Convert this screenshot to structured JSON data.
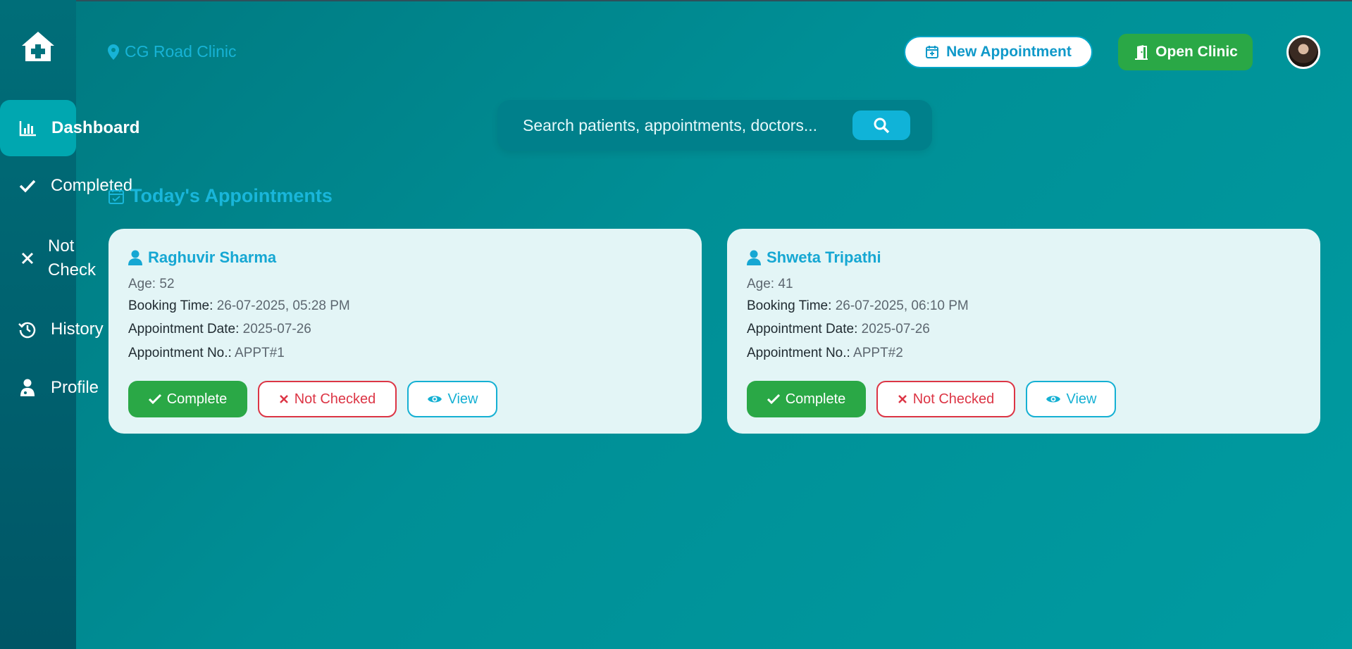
{
  "sidebar": {
    "items": [
      {
        "label": "Dashboard",
        "icon": "chart-bar-icon",
        "active": true
      },
      {
        "label": "Completed",
        "icon": "check-icon"
      },
      {
        "label": "Not Check",
        "icon": "x-icon"
      },
      {
        "label": "History",
        "icon": "history-icon"
      },
      {
        "label": "Profile",
        "icon": "doctor-icon"
      }
    ]
  },
  "header": {
    "location": "CG Road Clinic",
    "new_appointment_label": "New Appointment",
    "open_clinic_label": "Open Clinic"
  },
  "search": {
    "placeholder": "Search patients, appointments, doctors..."
  },
  "section": {
    "title": "Today's Appointments"
  },
  "appointments": [
    {
      "name": "Raghuvir Sharma",
      "age_label": "Age:",
      "age": "52",
      "booking_time_label": "Booking Time:",
      "booking_time": "26-07-2025, 05:28 PM",
      "appointment_date_label": "Appointment Date:",
      "appointment_date": "2025-07-26",
      "appointment_no_label": "Appointment No.:",
      "appointment_no": "APPT#1"
    },
    {
      "name": "Shweta Tripathi",
      "age_label": "Age:",
      "age": "41",
      "booking_time_label": "Booking Time:",
      "booking_time": "26-07-2025, 06:10 PM",
      "appointment_date_label": "Appointment Date:",
      "appointment_date": "2025-07-26",
      "appointment_no_label": "Appointment No.:",
      "appointment_no": "APPT#2"
    }
  ],
  "actions": {
    "complete_label": "Complete",
    "not_checked_label": "Not Checked",
    "view_label": "View"
  },
  "colors": {
    "accent": "#16a7d3",
    "success": "#2aa846",
    "danger": "#dc3545",
    "sidebar": "#006e79"
  }
}
